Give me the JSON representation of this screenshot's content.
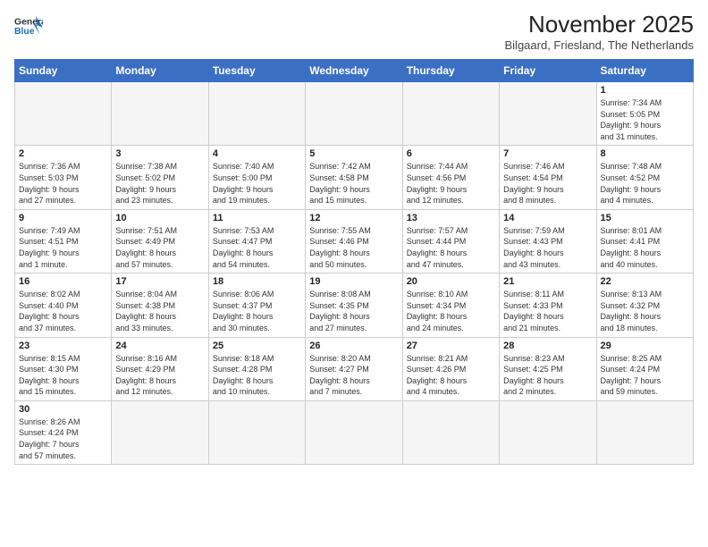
{
  "header": {
    "logo_general": "General",
    "logo_blue": "Blue",
    "month_title": "November 2025",
    "location": "Bilgaard, Friesland, The Netherlands"
  },
  "weekdays": [
    "Sunday",
    "Monday",
    "Tuesday",
    "Wednesday",
    "Thursday",
    "Friday",
    "Saturday"
  ],
  "weeks": [
    [
      {
        "day": "",
        "info": ""
      },
      {
        "day": "",
        "info": ""
      },
      {
        "day": "",
        "info": ""
      },
      {
        "day": "",
        "info": ""
      },
      {
        "day": "",
        "info": ""
      },
      {
        "day": "",
        "info": ""
      },
      {
        "day": "1",
        "info": "Sunrise: 7:34 AM\nSunset: 5:05 PM\nDaylight: 9 hours\nand 31 minutes."
      }
    ],
    [
      {
        "day": "2",
        "info": "Sunrise: 7:36 AM\nSunset: 5:03 PM\nDaylight: 9 hours\nand 27 minutes."
      },
      {
        "day": "3",
        "info": "Sunrise: 7:38 AM\nSunset: 5:02 PM\nDaylight: 9 hours\nand 23 minutes."
      },
      {
        "day": "4",
        "info": "Sunrise: 7:40 AM\nSunset: 5:00 PM\nDaylight: 9 hours\nand 19 minutes."
      },
      {
        "day": "5",
        "info": "Sunrise: 7:42 AM\nSunset: 4:58 PM\nDaylight: 9 hours\nand 15 minutes."
      },
      {
        "day": "6",
        "info": "Sunrise: 7:44 AM\nSunset: 4:56 PM\nDaylight: 9 hours\nand 12 minutes."
      },
      {
        "day": "7",
        "info": "Sunrise: 7:46 AM\nSunset: 4:54 PM\nDaylight: 9 hours\nand 8 minutes."
      },
      {
        "day": "8",
        "info": "Sunrise: 7:48 AM\nSunset: 4:52 PM\nDaylight: 9 hours\nand 4 minutes."
      }
    ],
    [
      {
        "day": "9",
        "info": "Sunrise: 7:49 AM\nSunset: 4:51 PM\nDaylight: 9 hours\nand 1 minute."
      },
      {
        "day": "10",
        "info": "Sunrise: 7:51 AM\nSunset: 4:49 PM\nDaylight: 8 hours\nand 57 minutes."
      },
      {
        "day": "11",
        "info": "Sunrise: 7:53 AM\nSunset: 4:47 PM\nDaylight: 8 hours\nand 54 minutes."
      },
      {
        "day": "12",
        "info": "Sunrise: 7:55 AM\nSunset: 4:46 PM\nDaylight: 8 hours\nand 50 minutes."
      },
      {
        "day": "13",
        "info": "Sunrise: 7:57 AM\nSunset: 4:44 PM\nDaylight: 8 hours\nand 47 minutes."
      },
      {
        "day": "14",
        "info": "Sunrise: 7:59 AM\nSunset: 4:43 PM\nDaylight: 8 hours\nand 43 minutes."
      },
      {
        "day": "15",
        "info": "Sunrise: 8:01 AM\nSunset: 4:41 PM\nDaylight: 8 hours\nand 40 minutes."
      }
    ],
    [
      {
        "day": "16",
        "info": "Sunrise: 8:02 AM\nSunset: 4:40 PM\nDaylight: 8 hours\nand 37 minutes."
      },
      {
        "day": "17",
        "info": "Sunrise: 8:04 AM\nSunset: 4:38 PM\nDaylight: 8 hours\nand 33 minutes."
      },
      {
        "day": "18",
        "info": "Sunrise: 8:06 AM\nSunset: 4:37 PM\nDaylight: 8 hours\nand 30 minutes."
      },
      {
        "day": "19",
        "info": "Sunrise: 8:08 AM\nSunset: 4:35 PM\nDaylight: 8 hours\nand 27 minutes."
      },
      {
        "day": "20",
        "info": "Sunrise: 8:10 AM\nSunset: 4:34 PM\nDaylight: 8 hours\nand 24 minutes."
      },
      {
        "day": "21",
        "info": "Sunrise: 8:11 AM\nSunset: 4:33 PM\nDaylight: 8 hours\nand 21 minutes."
      },
      {
        "day": "22",
        "info": "Sunrise: 8:13 AM\nSunset: 4:32 PM\nDaylight: 8 hours\nand 18 minutes."
      }
    ],
    [
      {
        "day": "23",
        "info": "Sunrise: 8:15 AM\nSunset: 4:30 PM\nDaylight: 8 hours\nand 15 minutes."
      },
      {
        "day": "24",
        "info": "Sunrise: 8:16 AM\nSunset: 4:29 PM\nDaylight: 8 hours\nand 12 minutes."
      },
      {
        "day": "25",
        "info": "Sunrise: 8:18 AM\nSunset: 4:28 PM\nDaylight: 8 hours\nand 10 minutes."
      },
      {
        "day": "26",
        "info": "Sunrise: 8:20 AM\nSunset: 4:27 PM\nDaylight: 8 hours\nand 7 minutes."
      },
      {
        "day": "27",
        "info": "Sunrise: 8:21 AM\nSunset: 4:26 PM\nDaylight: 8 hours\nand 4 minutes."
      },
      {
        "day": "28",
        "info": "Sunrise: 8:23 AM\nSunset: 4:25 PM\nDaylight: 8 hours\nand 2 minutes."
      },
      {
        "day": "29",
        "info": "Sunrise: 8:25 AM\nSunset: 4:24 PM\nDaylight: 7 hours\nand 59 minutes."
      }
    ],
    [
      {
        "day": "30",
        "info": "Sunrise: 8:26 AM\nSunset: 4:24 PM\nDaylight: 7 hours\nand 57 minutes."
      },
      {
        "day": "",
        "info": ""
      },
      {
        "day": "",
        "info": ""
      },
      {
        "day": "",
        "info": ""
      },
      {
        "day": "",
        "info": ""
      },
      {
        "day": "",
        "info": ""
      },
      {
        "day": "",
        "info": ""
      }
    ]
  ]
}
